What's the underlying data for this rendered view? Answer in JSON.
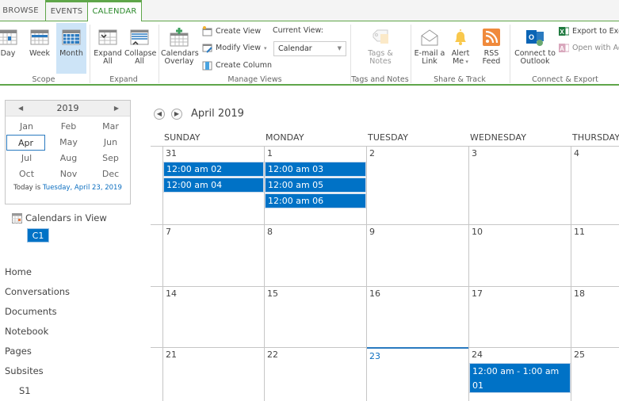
{
  "tabs": [
    {
      "label": "BROWSE",
      "active": false
    },
    {
      "label": "EVENTS",
      "active": false
    },
    {
      "label": "CALENDAR",
      "active": true
    }
  ],
  "ribbon": {
    "scope": {
      "label": "Scope",
      "buttons": [
        {
          "label": "Day",
          "icon": "day-view-icon",
          "selected": false
        },
        {
          "label": "Week",
          "icon": "week-view-icon",
          "selected": false
        },
        {
          "label": "Month",
          "icon": "month-view-icon",
          "selected": true
        }
      ]
    },
    "expand": {
      "label": "Expand",
      "buttons": [
        {
          "label_line1": "Expand",
          "label_line2": "All",
          "icon": "expand-all-icon"
        },
        {
          "label_line1": "Collapse",
          "label_line2": "All",
          "icon": "collapse-all-icon"
        }
      ]
    },
    "manage_views": {
      "label": "Manage Views",
      "calendars_overlay": {
        "label_line1": "Calendars",
        "label_line2": "Overlay"
      },
      "create_view": "Create View",
      "modify_view": "Modify View",
      "create_column": "Create Column",
      "current_view_label": "Current View:",
      "current_view_value": "Calendar"
    },
    "tags_notes": {
      "label": "Tags and Notes",
      "button": {
        "label_line1": "Tags &",
        "label_line2": "Notes"
      }
    },
    "share_track": {
      "label": "Share & Track",
      "buttons": [
        {
          "label_line1": "E-mail a",
          "label_line2": "Link"
        },
        {
          "label_line1": "Alert",
          "label_line2": "Me"
        },
        {
          "label_line1": "RSS",
          "label_line2": "Feed"
        }
      ]
    },
    "connect_export": {
      "label": "Connect & Export",
      "connect_outlook": {
        "label_line1": "Connect to",
        "label_line2": "Outlook"
      },
      "export_excel": "Export to Excel",
      "open_access": "Open with Access"
    }
  },
  "datepicker": {
    "year": "2019",
    "months": [
      "Jan",
      "Feb",
      "Mar",
      "Apr",
      "May",
      "Jun",
      "Jul",
      "Aug",
      "Sep",
      "Oct",
      "Nov",
      "Dec"
    ],
    "selected_month": "Apr",
    "today_prefix": "Today is ",
    "today_link": "Tuesday, April 23, 2019"
  },
  "calendars_in_view": {
    "label": "Calendars in View",
    "items": [
      "C1"
    ]
  },
  "nav_links": [
    "Home",
    "Conversations",
    "Documents",
    "Notebook",
    "Pages",
    "Subsites",
    "S1"
  ],
  "calendar": {
    "title": "April 2019",
    "day_headers": [
      "SUNDAY",
      "MONDAY",
      "TUESDAY",
      "WEDNESDAY",
      "THURSDAY"
    ],
    "weeks": [
      [
        "31",
        "1",
        "2",
        "3",
        "4"
      ],
      [
        "7",
        "8",
        "9",
        "10",
        "11"
      ],
      [
        "14",
        "15",
        "16",
        "17",
        "18"
      ],
      [
        "21",
        "22",
        "23",
        "24",
        "25"
      ]
    ],
    "today": "23",
    "events": [
      {
        "day": "31",
        "text": "12:00 am 02"
      },
      {
        "day": "31",
        "text": "12:00 am 04"
      },
      {
        "day": "1",
        "text": "12:00 am 03"
      },
      {
        "day": "1",
        "text": "12:00 am 05"
      },
      {
        "day": "1",
        "text": "12:00 am 06"
      },
      {
        "day": "24",
        "text": "12:00 am - 1:00 am",
        "text2": "01"
      }
    ],
    "event_color": "#0072c6"
  },
  "colors": {
    "accent_green": "#5fa64a",
    "link_blue": "#0d6fc0",
    "selected_bg": "#cde4f7"
  }
}
